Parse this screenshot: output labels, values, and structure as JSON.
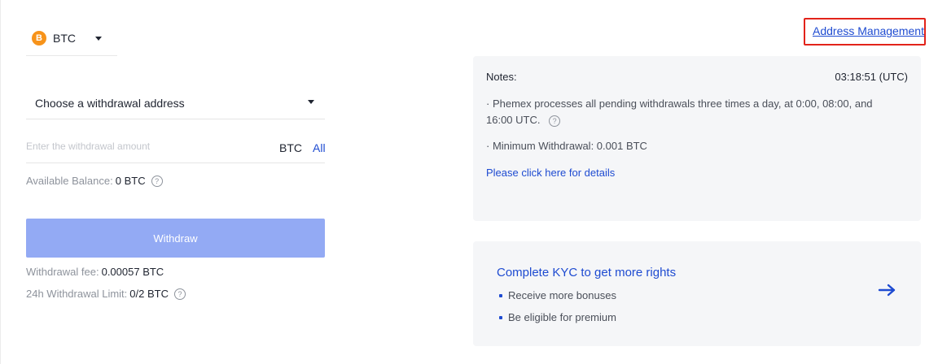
{
  "coin": {
    "icon": "bitcoin-icon",
    "symbol_glyph": "B",
    "label": "BTC"
  },
  "address": {
    "label": "Choose a withdrawal address"
  },
  "amount": {
    "placeholder": "Enter the withdrawal amount",
    "unit": "BTC",
    "all_label": "All"
  },
  "balance": {
    "label": "Available Balance:",
    "value": "0 BTC"
  },
  "withdraw_button": "Withdraw",
  "fee": {
    "label": "Withdrawal fee:",
    "value": "0.00057 BTC"
  },
  "limit": {
    "label": "24h Withdrawal Limit:",
    "value": "0/2 BTC"
  },
  "address_management": "Address Management",
  "notes": {
    "title": "Notes:",
    "time": "03:18:51 (UTC)",
    "items": [
      "· Phemex processes all pending withdrawals three times a day, at 0:00, 08:00, and 16:00 UTC.",
      "· Minimum Withdrawal: 0.001 BTC"
    ],
    "details_link": "Please click here for details"
  },
  "kyc": {
    "title": "Complete KYC to get more rights",
    "items": [
      "Receive more bonuses",
      "Be eligible for premium"
    ]
  },
  "colors": {
    "accent": "#1e4bd1",
    "button": "#93aaf4",
    "panel": "#f5f6f8",
    "highlight": "#e2231a",
    "btc": "#f7931a"
  },
  "help_glyph": "?"
}
